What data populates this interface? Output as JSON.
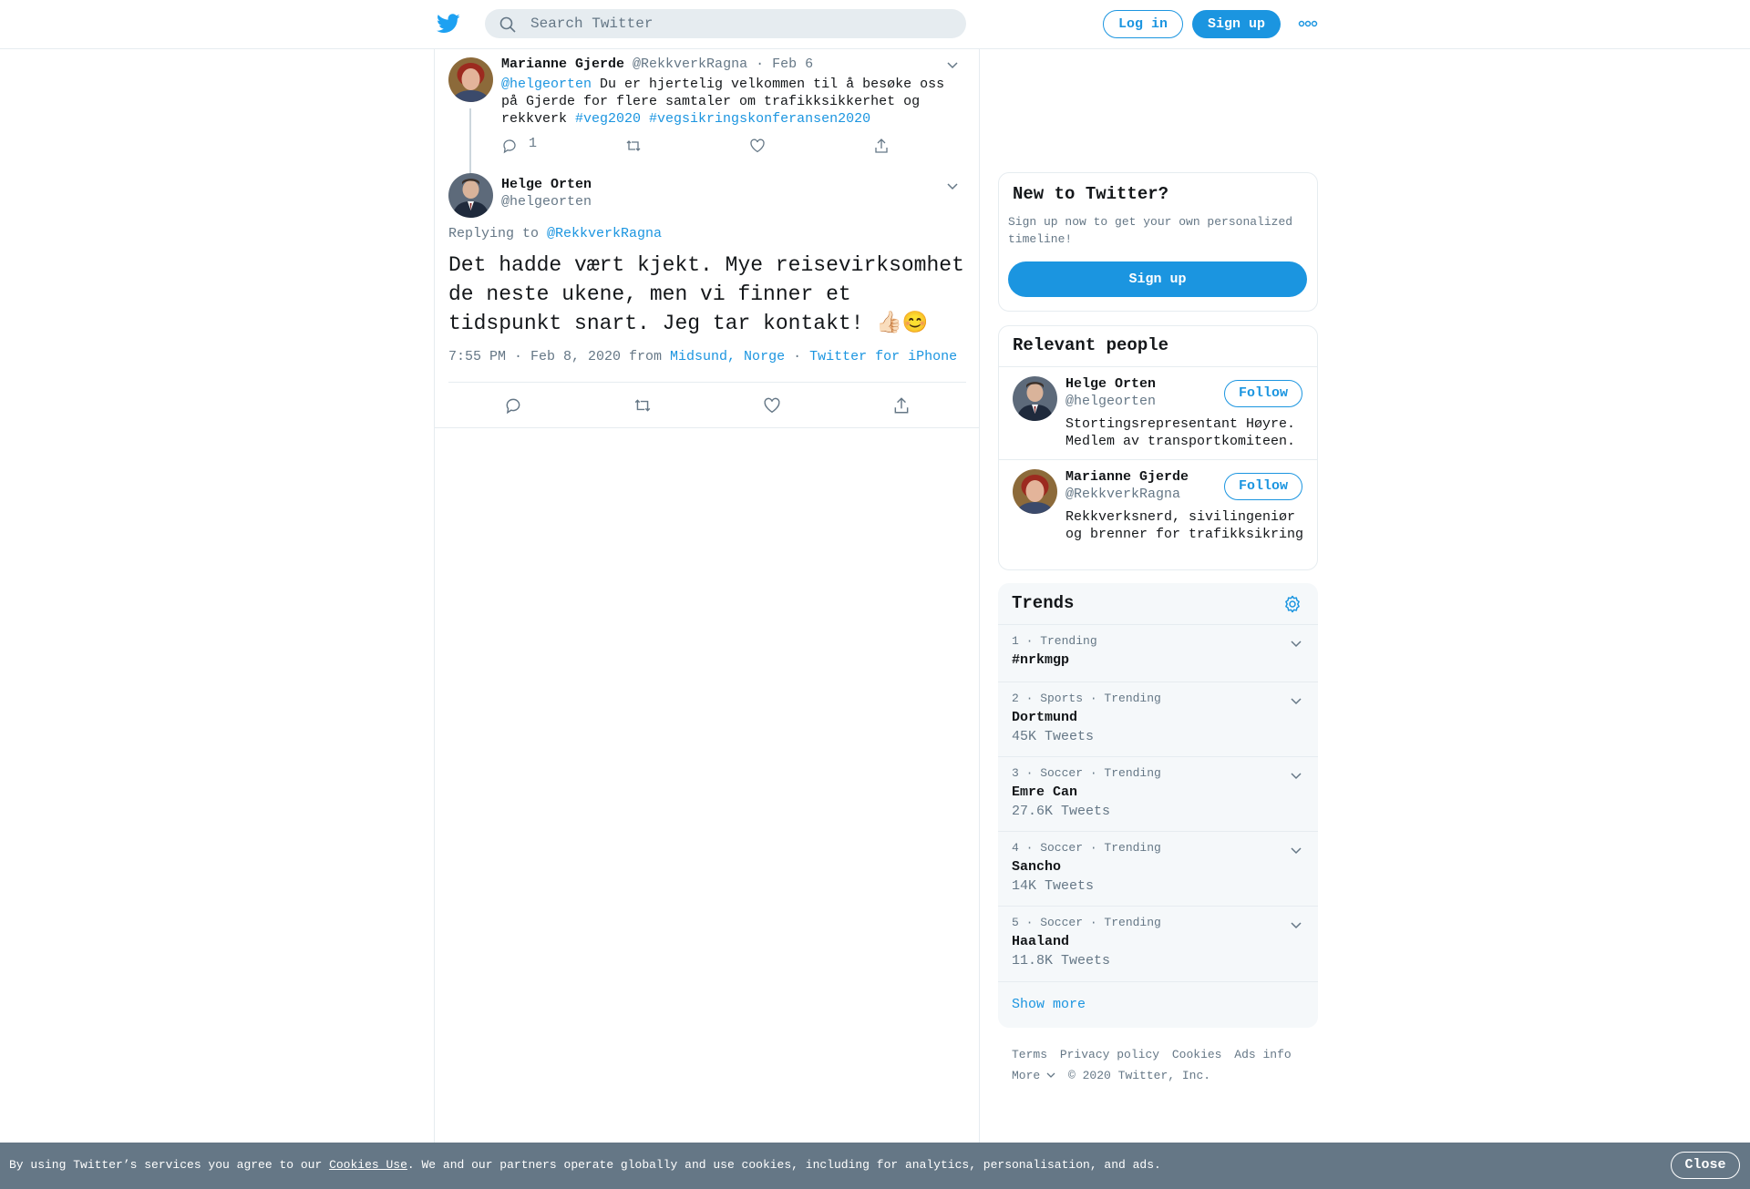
{
  "header": {
    "logo": "twitter-bird-icon",
    "search_placeholder": "Search Twitter",
    "login_label": "Log in",
    "signup_label": "Sign up",
    "more_icon": "more-dots-icon"
  },
  "colors": {
    "accent": "#1b95e0",
    "text": "#14171a",
    "secondary": "#657786",
    "border": "#e6ecf0",
    "cookie_bg": "#657786"
  },
  "thread": {
    "parent": {
      "name": "Marianne Gjerde",
      "handle": "@RekkverkRagna",
      "separator": "·",
      "date": "Feb 6",
      "mention": "@helgeorten",
      "text_a": " Du er hjertelig velkommen til å besøke oss på Gjerde for flere samtaler om trafikksikkerhet og rekkverk ",
      "hashtag1": "#veg2020",
      "hashtag2": "#vegsikringskonferansen2020",
      "reply_count": "1"
    },
    "main": {
      "name": "Helge Orten",
      "handle": "@helgeorten",
      "replying_label": "Replying to ",
      "replying_handle": "@RekkverkRagna",
      "text": "Det hadde vært kjekt. Mye reisevirksomhet de neste ukene, men vi finner et tidspunkt snart. Jeg tar kontakt! 👍🏻😊",
      "time": "7:55 PM · Feb 8, 2020 from ",
      "location": "Midsund, Norge",
      "separator": " · ",
      "source": "Twitter for iPhone"
    }
  },
  "signup_card": {
    "title": "New to Twitter?",
    "subtitle": "Sign up now to get your own personalized timeline!",
    "button": "Sign up"
  },
  "relevant_people": {
    "title": "Relevant people",
    "people": [
      {
        "name": "Helge Orten",
        "handle": "@helgeorten",
        "bio": "Stortingsrepresentant Høyre. Medlem av transportkomiteen.",
        "follow": "Follow"
      },
      {
        "name": "Marianne Gjerde",
        "handle": "@RekkverkRagna",
        "bio": "Rekkverksnerd, sivilingeniør og brenner for trafikksikring",
        "follow": "Follow"
      }
    ]
  },
  "trends": {
    "title": "Trends",
    "items": [
      {
        "meta": "1 · Trending",
        "name": "#nrkmgp",
        "count": ""
      },
      {
        "meta": "2 · Sports · Trending",
        "name": "Dortmund",
        "count": "45K Tweets"
      },
      {
        "meta": "3 · Soccer · Trending",
        "name": "Emre Can",
        "count": "27.6K Tweets"
      },
      {
        "meta": "4 · Soccer · Trending",
        "name": "Sancho",
        "count": "14K Tweets"
      },
      {
        "meta": "5 · Soccer · Trending",
        "name": "Haaland",
        "count": "11.8K Tweets"
      }
    ],
    "show_more": "Show more"
  },
  "footer": {
    "terms": "Terms",
    "privacy": "Privacy policy",
    "cookies": "Cookies",
    "ads": "Ads info",
    "more": "More",
    "copyright": "© 2020 Twitter, Inc."
  },
  "cookie_bar": {
    "text_before": "By using Twitter’s services you agree to our ",
    "link": "Cookies Use",
    "text_after": ". We and our partners operate globally and use cookies, including for analytics, personalisation, and ads.",
    "close": "Close"
  }
}
